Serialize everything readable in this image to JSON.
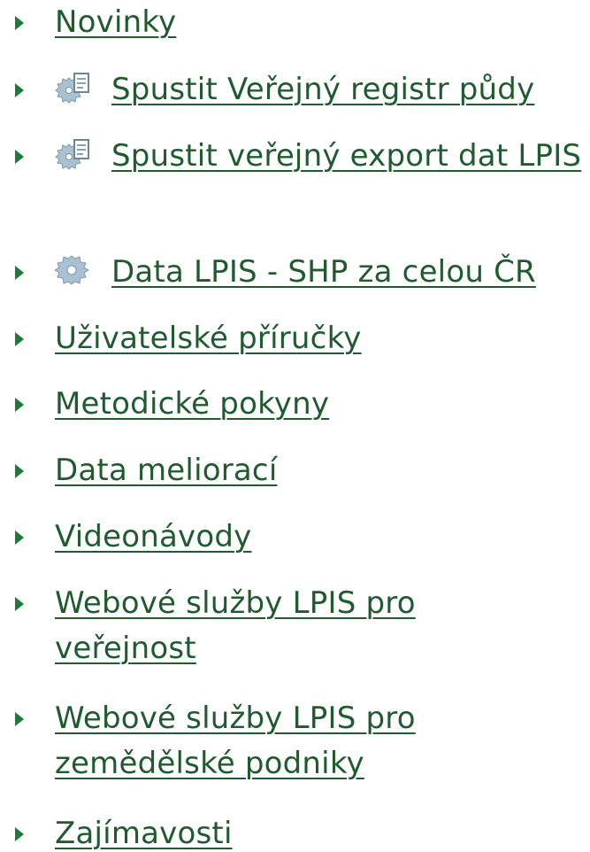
{
  "colors": {
    "link": "#1f5b2f",
    "bullet": "#1e7a39"
  },
  "menu": {
    "items": [
      {
        "label": "Novinky",
        "icon": ""
      },
      {
        "label": "Spustit Veřejný registr půdy",
        "icon": "gear-document-icon"
      },
      {
        "label": "Spustit veřejný export dat LPIS",
        "icon": "gear-document-icon"
      },
      {
        "label": "Data LPIS - SHP za celou ČR",
        "icon": "gear-icon"
      },
      {
        "label": "Uživatelské příručky",
        "icon": ""
      },
      {
        "label": "Metodické pokyny",
        "icon": ""
      },
      {
        "label": "Data meliorací",
        "icon": ""
      },
      {
        "label": "Videonávody",
        "icon": ""
      },
      {
        "label": "Webové služby LPIS pro veřejnost",
        "icon": ""
      },
      {
        "label": "Webové služby LPIS pro zemědělské podniky",
        "icon": ""
      },
      {
        "label": "Zajímavosti",
        "icon": ""
      }
    ]
  }
}
